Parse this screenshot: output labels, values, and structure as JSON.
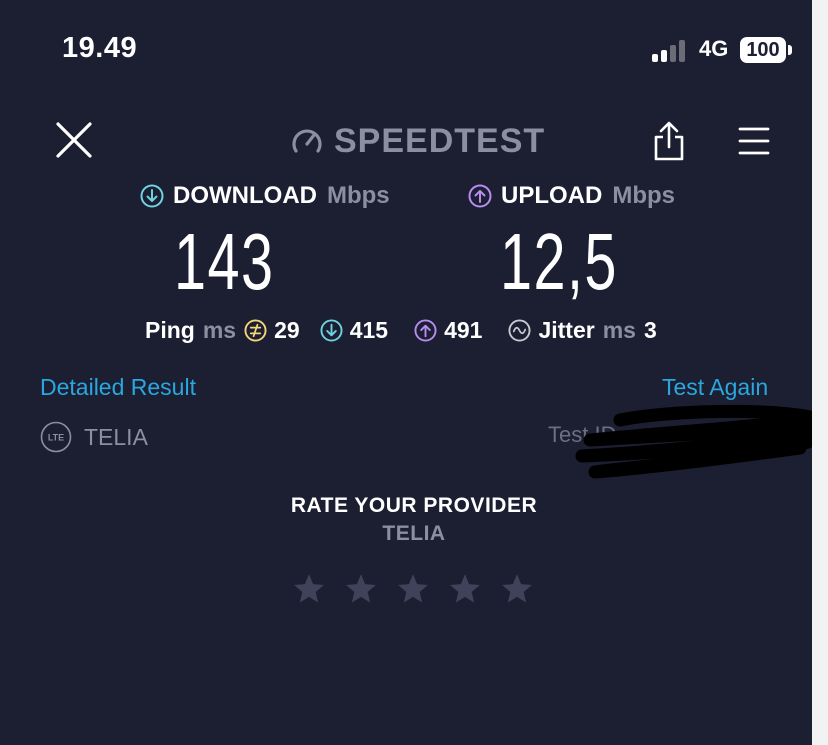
{
  "status_bar": {
    "time": "19.49",
    "network": "4G",
    "battery": "100"
  },
  "header": {
    "brand": "SPEEDTEST"
  },
  "download": {
    "label": "DOWNLOAD",
    "unit": "Mbps",
    "value": "143"
  },
  "upload": {
    "label": "UPLOAD",
    "unit": "Mbps",
    "value": "12,5"
  },
  "latency": {
    "ping_label": "Ping",
    "ping_unit": "ms",
    "idle": "29",
    "download": "415",
    "upload": "491",
    "jitter_label": "Jitter",
    "jitter_unit": "ms",
    "jitter": "3"
  },
  "links": {
    "detailed": "Detailed Result",
    "again": "Test Again"
  },
  "provider": {
    "badge": "LTE",
    "name": "TELIA",
    "test_id_label": "Test ID"
  },
  "rating": {
    "title": "RATE YOUR PROVIDER",
    "provider": "TELIA",
    "stars": 5,
    "selected": 0
  },
  "colors": {
    "background": "#1c1e31",
    "download": "#6ed3e0",
    "upload": "#b88cf0",
    "idle": "#f4d67a",
    "link": "#2aa7df",
    "muted": "#8d8e9f",
    "star": "#3f4259"
  },
  "icons": [
    "close-icon",
    "speedometer-icon",
    "share-icon",
    "menu-icon",
    "download-arrow-icon",
    "upload-arrow-icon",
    "idle-ping-icon",
    "jitter-icon",
    "lte-icon",
    "star-icon"
  ]
}
